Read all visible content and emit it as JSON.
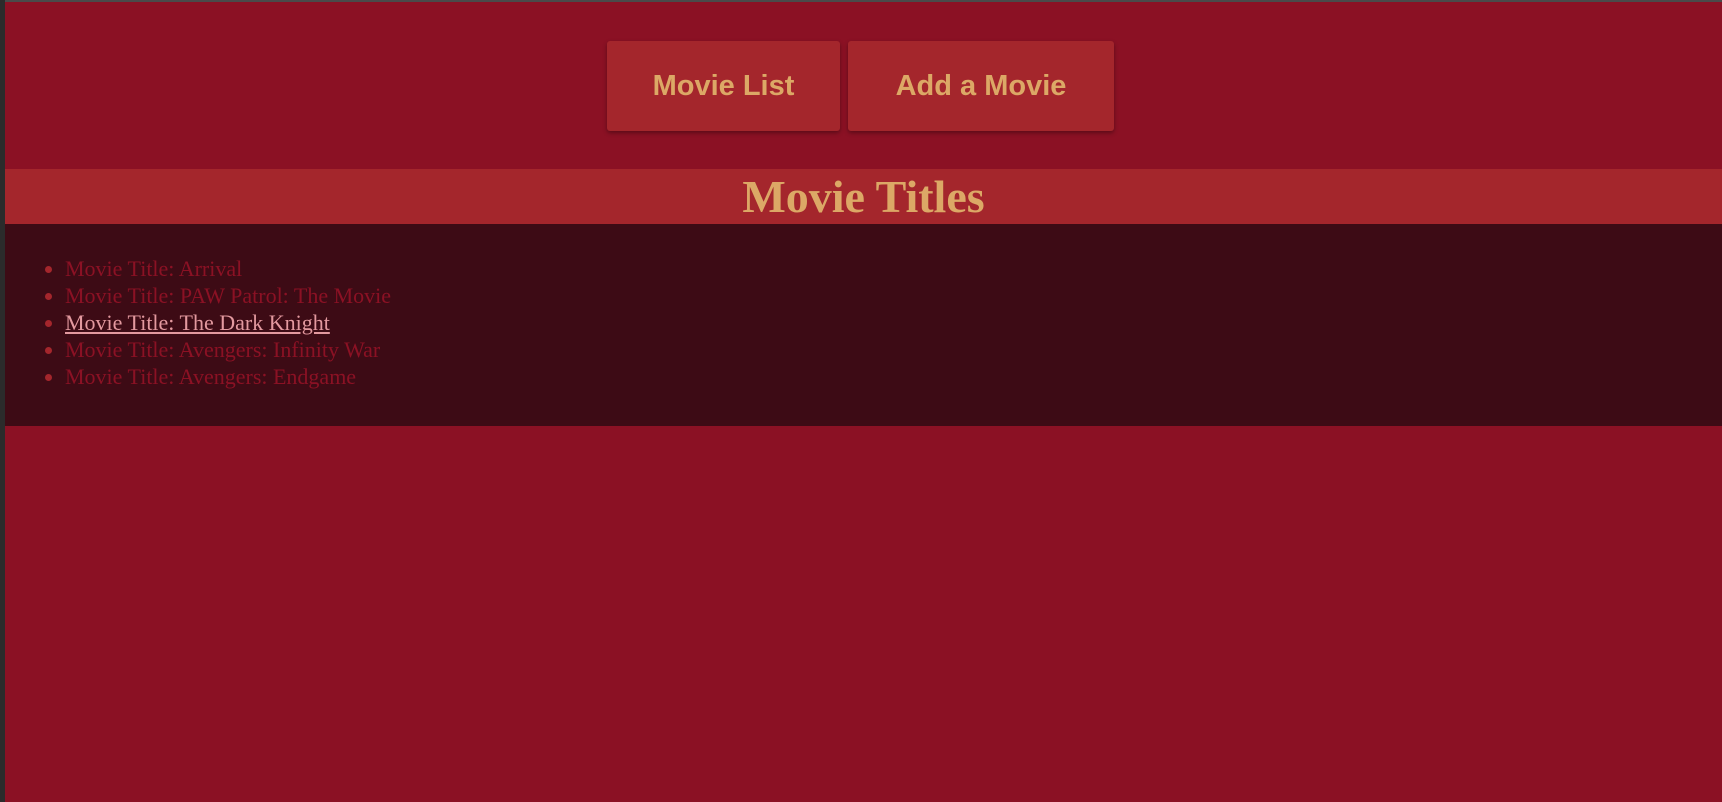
{
  "nav": {
    "movie_list_label": "Movie List",
    "add_movie_label": "Add a Movie"
  },
  "header": {
    "title": "Movie Titles"
  },
  "movies": [
    {
      "label": "Movie Title: Arrival"
    },
    {
      "label": "Movie Title: PAW Patrol: The Movie"
    },
    {
      "label": "Movie Title: The Dark Knight"
    },
    {
      "label": "Movie Title: Avengers: Infinity War"
    },
    {
      "label": "Movie Title: Avengers: Endgame"
    }
  ],
  "colors": {
    "background": "#8b1124",
    "button_bg": "#a4262c",
    "accent_text": "#dca866",
    "list_panel_bg": "#3d0b15",
    "hover_link": "#e3999f"
  }
}
